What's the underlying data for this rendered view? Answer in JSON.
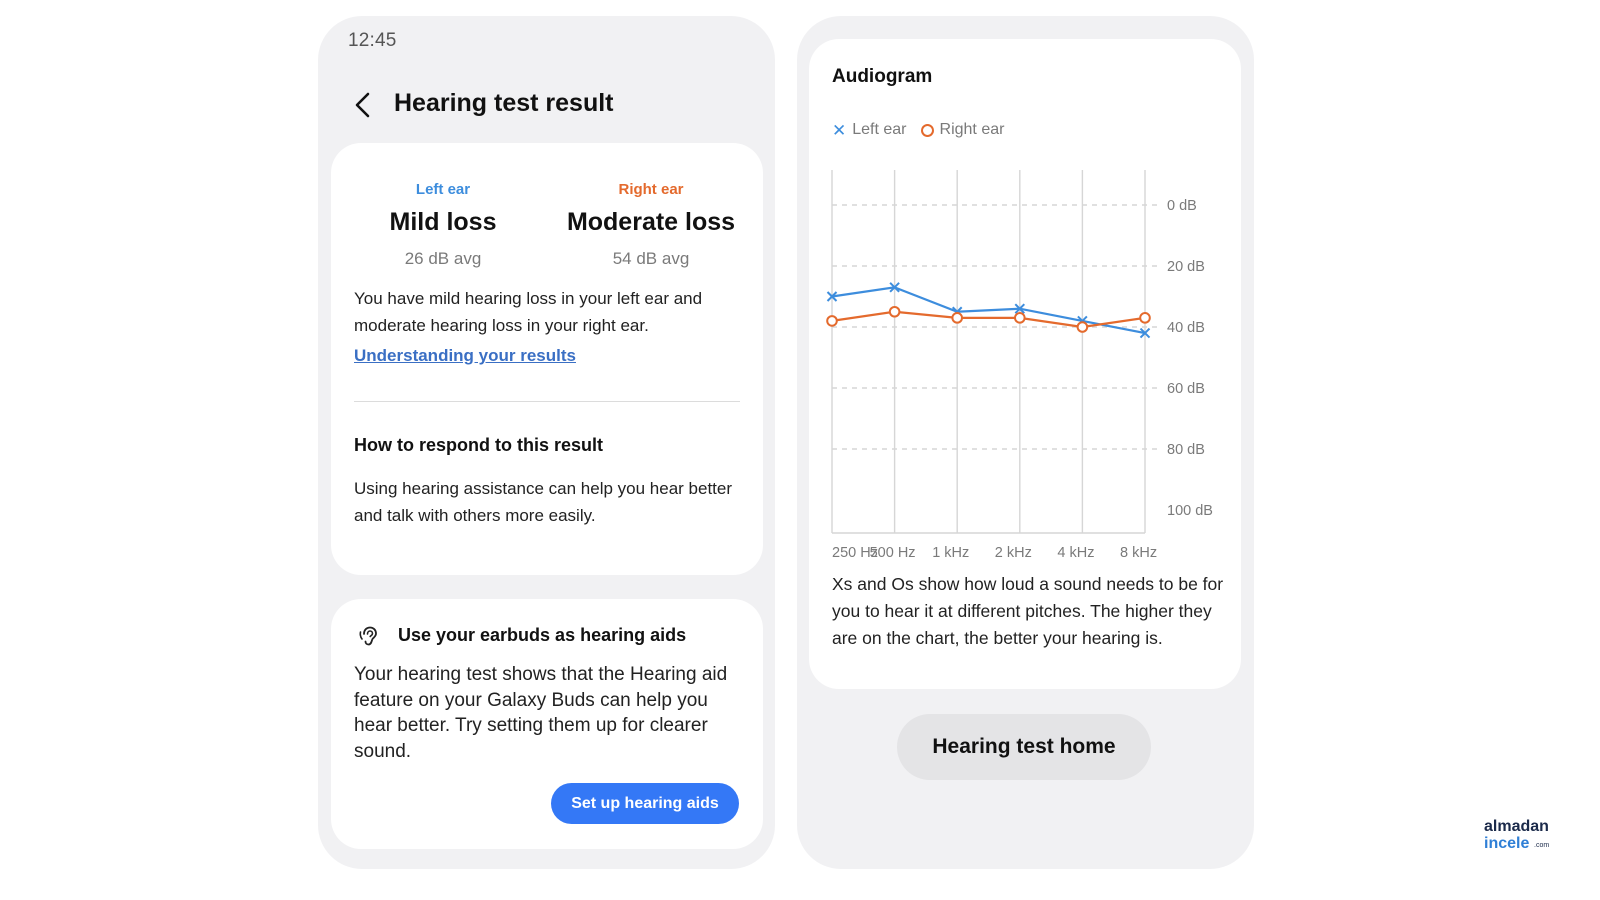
{
  "status_bar": {
    "time": "12:45"
  },
  "header": {
    "back_icon": "chevron-left-icon",
    "title": "Hearing test result"
  },
  "result_card": {
    "left_ear": {
      "label": "Left ear",
      "level": "Mild loss",
      "avg": "26 dB avg",
      "color": "#3d8ddd"
    },
    "right_ear": {
      "label": "Right ear",
      "level": "Moderate loss",
      "avg": "54 dB avg",
      "color": "#e46a2d"
    },
    "summary": "You have mild hearing loss in your left ear and moderate hearing loss in your right ear.",
    "link": "Understanding your results",
    "respond_heading": "How to respond to this result",
    "respond_text": "Using hearing assistance can help you hear better and talk with others more easily."
  },
  "earbuds_card": {
    "icon": "hearing-aid-icon",
    "heading": "Use your earbuds as hearing aids",
    "text": "Your hearing test shows that the Hearing aid feature on your Galaxy Buds can help you hear better. Try setting them up for clearer sound.",
    "button": "Set up hearing aids",
    "button_color": "#3478f6"
  },
  "audiogram": {
    "title": "Audiogram",
    "legend": {
      "left_label": "Left ear",
      "right_label": "Right ear"
    },
    "description": "Xs and Os show how loud a sound needs to be for you to hear it at different pitches. The higher they are on the chart, the better your hearing is.",
    "home_button": "Hearing test home"
  },
  "chart_data": {
    "type": "line",
    "title": "Audiogram",
    "categories": [
      "250 Hz",
      "500 Hz",
      "1 kHz",
      "2 kHz",
      "4 kHz",
      "8 kHz"
    ],
    "y_ticks": [
      "0 dB",
      "20 dB",
      "40 dB",
      "60 dB",
      "80 dB",
      "100 dB"
    ],
    "ylim": [
      0,
      100
    ],
    "y_inverted": true,
    "grid": true,
    "legend_position": "top-left",
    "series": [
      {
        "name": "Left ear",
        "marker": "x",
        "color": "#3d8ddd",
        "values": [
          30,
          27,
          35,
          34,
          38,
          42
        ]
      },
      {
        "name": "Right ear",
        "marker": "o",
        "color": "#e46a2d",
        "values": [
          38,
          35,
          37,
          37,
          40,
          37
        ]
      }
    ]
  },
  "watermark": {
    "line1": "almadan",
    "line2": "incele",
    "suffix": ".com"
  }
}
